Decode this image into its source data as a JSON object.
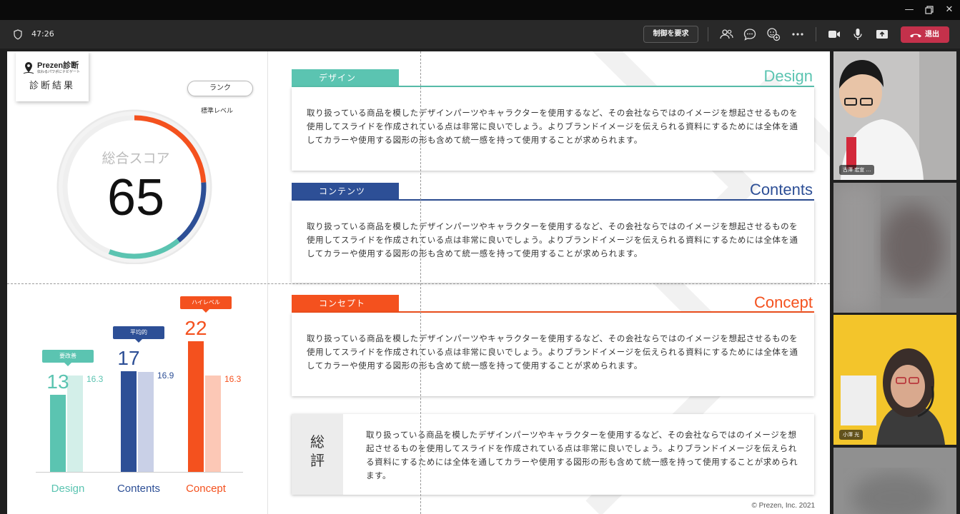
{
  "meeting": {
    "elapsed_time": "47:26",
    "request_control_label": "制御を要求",
    "leave_label": "退出"
  },
  "slide": {
    "logo": {
      "name": "Prezen診断",
      "tagline": "伝わるパワポにナビゲート"
    },
    "result_title": "診断結果",
    "rank": {
      "label": "ランク",
      "value": "標準レベル"
    },
    "total_score": {
      "label": "総合スコア",
      "value": "65"
    },
    "bar_chart": {
      "categories": [
        {
          "name": "Design",
          "score": 13,
          "score_label": "13",
          "average": 16.3,
          "average_label": "16.3",
          "tag": "要改善",
          "color": "#5bc4b1",
          "light_color": "#d3efe9"
        },
        {
          "name": "Contents",
          "score": 17,
          "score_label": "17",
          "average": 16.9,
          "average_label": "16.9",
          "tag": "平均的",
          "color": "#2d4f96",
          "light_color": "#c9d0e7"
        },
        {
          "name": "Concept",
          "score": 22,
          "score_label": "22",
          "average": 16.3,
          "average_label": "16.3",
          "tag": "ハイレベル",
          "color": "#f4511e",
          "light_color": "#fcc8b6"
        }
      ]
    },
    "sections": [
      {
        "tab": "デザイン",
        "title_en": "Design",
        "color": "#5bc4b1",
        "text": "取り扱っている商品を模したデザインパーツやキャラクターを使用するなど、その会社ならではのイメージを想起させるものを使用してスライドを作成されている点は非常に良いでしょう。よりブランドイメージを伝えられる資料にするためには全体を通してカラーや使用する図形の形も含めて統一感を持って使用することが求められます。"
      },
      {
        "tab": "コンテンツ",
        "title_en": "Contents",
        "color": "#2d4f96",
        "text": "取り扱っている商品を模したデザインパーツやキャラクターを使用するなど、その会社ならではのイメージを想起させるものを使用してスライドを作成されている点は非常に良いでしょう。よりブランドイメージを伝えられる資料にするためには全体を通してカラーや使用する図形の形も含めて統一感を持って使用することが求められます。"
      },
      {
        "tab": "コンセプト",
        "title_en": "Concept",
        "color": "#f4511e",
        "text": "取り扱っている商品を模したデザインパーツやキャラクターを使用するなど、その会社ならではのイメージを想起させるものを使用してスライドを作成されている点は非常に良いでしょう。よりブランドイメージを伝えられる資料にするためには全体を通してカラーや使用する図形の形も含めて統一感を持って使用することが求められます。"
      }
    ],
    "summary": {
      "heading": "総評",
      "text": "取り扱っている商品を模したデザインパーツやキャラクターを使用するなど、その会社ならではのイメージを想起させるものを使用してスライドを作成されている点は非常に良いでしょう。よりブランドイメージを伝えられる資料にするためには全体を通してカラーや使用する図形の形も含めて統一感を持って使用することが求められます。"
    },
    "copyright": "© Prezen, Inc. 2021"
  },
  "participants": [
    {
      "name": "古澤 宏宣",
      "more": "…"
    },
    {
      "name": ""
    },
    {
      "name": "小澤 光"
    },
    {
      "name": ""
    }
  ],
  "icons": [
    "shield-icon",
    "participants-icon",
    "chat-icon",
    "reactions-icon",
    "more-icon",
    "camera-icon",
    "microphone-icon",
    "share-screen-icon",
    "hang-up-icon",
    "minimize-icon",
    "restore-icon",
    "close-icon",
    "location-pin-icon"
  ]
}
